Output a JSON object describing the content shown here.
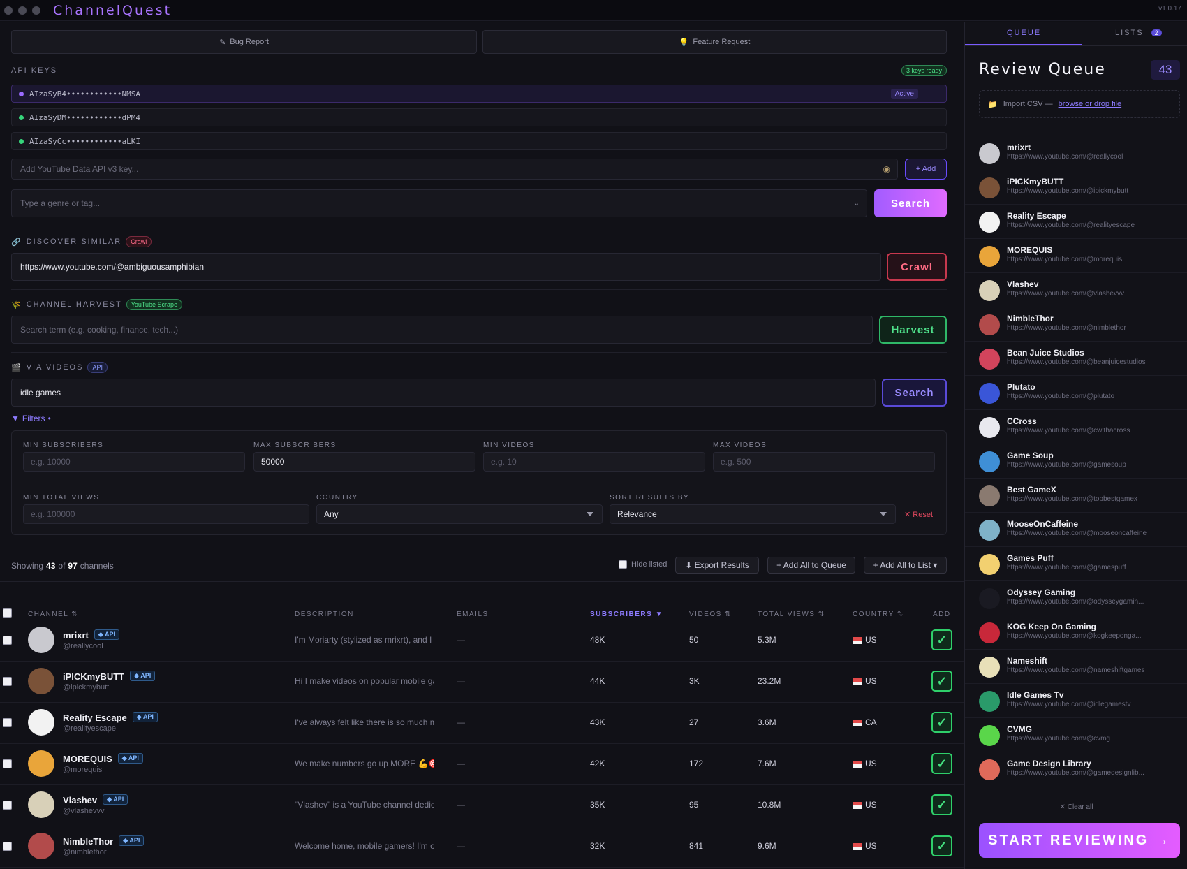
{
  "app": {
    "title": "ChannelQuest",
    "version": "v1.0.17"
  },
  "top_buttons": {
    "bug": "Bug Report",
    "feature": "Feature Request"
  },
  "api_keys": {
    "label": "API KEYS",
    "ready_badge": "3 keys ready",
    "keys": [
      {
        "value": "AIzaSyB4••••••••••••NMSA",
        "status": "Active"
      },
      {
        "value": "AIzaSyDM••••••••••••dPM4"
      },
      {
        "value": "AIzaSyCc••••••••••••aLKI"
      }
    ],
    "add_placeholder": "Add YouTube Data API v3 key...",
    "add_button": "+ Add"
  },
  "genre_search": {
    "placeholder": "Type a genre or tag...",
    "button": "Search"
  },
  "discover": {
    "label": "DISCOVER SIMILAR",
    "badge": "Crawl",
    "value": "https://www.youtube.com/@ambiguousamphibian",
    "button": "Crawl"
  },
  "harvest": {
    "label": "CHANNEL HARVEST",
    "badge": "YouTube Scrape",
    "placeholder": "Search term (e.g. cooking, finance, tech...)",
    "button": "Harvest"
  },
  "via_videos": {
    "label": "VIA VIDEOS",
    "badge": "API",
    "value": "idle games",
    "button": "Search"
  },
  "filters": {
    "toggle": "Filters",
    "min_subs": {
      "label": "MIN SUBSCRIBERS",
      "placeholder": "e.g. 10000"
    },
    "max_subs": {
      "label": "MAX SUBSCRIBERS",
      "value": "50000"
    },
    "min_videos": {
      "label": "MIN VIDEOS",
      "placeholder": "e.g. 10"
    },
    "max_videos": {
      "label": "MAX VIDEOS",
      "placeholder": "e.g. 500"
    },
    "min_views": {
      "label": "MIN TOTAL VIEWS",
      "placeholder": "e.g. 100000"
    },
    "country": {
      "label": "COUNTRY",
      "value": "Any"
    },
    "sort": {
      "label": "SORT RESULTS BY",
      "value": "Relevance"
    },
    "reset": "✕ Reset"
  },
  "results": {
    "showing_prefix": "Showing",
    "shown": "43",
    "of": "of",
    "total": "97",
    "suffix": "channels",
    "hide_listed": "Hide listed",
    "export": "⬇ Export Results",
    "add_all_queue": "+ Add All to Queue",
    "add_all_list": "+ Add All to List ▾"
  },
  "table": {
    "headers": {
      "channel": "CHANNEL ⇅",
      "description": "DESCRIPTION",
      "emails": "EMAILS",
      "subscribers": "SUBSCRIBERS ▼",
      "videos": "VIDEOS ⇅",
      "views": "TOTAL VIEWS ⇅",
      "country": "COUNTRY ⇅",
      "add": "ADD"
    },
    "api_tag": "◆ API",
    "rows": [
      {
        "name": "mrixrt",
        "handle": "@reallycool",
        "desc": "I'm Moriarty (stylized as mrixrt), and I make",
        "email": "—",
        "subs": "48K",
        "videos": "50",
        "views": "5.3M",
        "country": "US"
      },
      {
        "name": "iPICKmyBUTT",
        "handle": "@ipickmybutt",
        "desc": "Hi I make videos on popular mobile games",
        "email": "—",
        "subs": "44K",
        "videos": "3K",
        "views": "23.2M",
        "country": "US"
      },
      {
        "name": "Reality Escape",
        "handle": "@realityescape",
        "desc": "I've always felt like there is so much more",
        "email": "—",
        "subs": "43K",
        "videos": "27",
        "views": "3.6M",
        "country": "CA"
      },
      {
        "name": "MOREQUIS",
        "handle": "@morequis",
        "desc": "We make numbers go up MORE 💪🎯",
        "email": "—",
        "subs": "42K",
        "videos": "172",
        "views": "7.6M",
        "country": "US"
      },
      {
        "name": "Vlashev",
        "handle": "@vlashevvv",
        "desc": "\"Vlashev\" is a YouTube channel dedicated",
        "email": "—",
        "subs": "35K",
        "videos": "95",
        "views": "10.8M",
        "country": "US"
      },
      {
        "name": "NimbleThor",
        "handle": "@nimblethor",
        "desc": "Welcome home, mobile gamers! I'm o",
        "email": "—",
        "subs": "32K",
        "videos": "841",
        "views": "9.6M",
        "country": "US"
      },
      {
        "name": "Bean Juice Studios",
        "handle": "",
        "desc": "",
        "email": "",
        "subs": "",
        "videos": "",
        "views": "",
        "country": ""
      }
    ]
  },
  "sidebar": {
    "tabs": {
      "queue": "QUEUE",
      "lists": "LISTS",
      "lists_count": "2"
    },
    "title": "Review Queue",
    "count": "43",
    "import_text": "Import CSV —",
    "import_link": "browse or drop file",
    "queue": [
      {
        "name": "mrixrt",
        "url": "https://www.youtube.com/@reallycool",
        "color": "#c9c9cf"
      },
      {
        "name": "iPICKmyBUTT",
        "url": "https://www.youtube.com/@ipickmybutt",
        "color": "#7a5238"
      },
      {
        "name": "Reality Escape",
        "url": "https://www.youtube.com/@realityescape",
        "color": "#f2f2f2"
      },
      {
        "name": "MOREQUIS",
        "url": "https://www.youtube.com/@morequis",
        "color": "#e9a53a"
      },
      {
        "name": "Vlashev",
        "url": "https://www.youtube.com/@vlashevvv",
        "color": "#d8d0b8"
      },
      {
        "name": "NimbleThor",
        "url": "https://www.youtube.com/@nimblethor",
        "color": "#b24b4b"
      },
      {
        "name": "Bean Juice Studios",
        "url": "https://www.youtube.com/@beanjuicestudios",
        "color": "#d2445c"
      },
      {
        "name": "Plutato",
        "url": "https://www.youtube.com/@plutato",
        "color": "#3a56d8"
      },
      {
        "name": "CCross",
        "url": "https://www.youtube.com/@cwithacross",
        "color": "#e8e8ee"
      },
      {
        "name": "Game Soup",
        "url": "https://www.youtube.com/@gamesoup",
        "color": "#3f8fd6"
      },
      {
        "name": "Best GameX",
        "url": "https://www.youtube.com/@topbestgamex",
        "color": "#8a7a70"
      },
      {
        "name": "MooseOnCaffeine",
        "url": "https://www.youtube.com/@mooseoncaffeine",
        "color": "#7fb2c8"
      },
      {
        "name": "Games Puff",
        "url": "https://www.youtube.com/@gamespuff",
        "color": "#f2d070"
      },
      {
        "name": "Odyssey Gaming",
        "url": "https://www.youtube.com/@odysseygamin...",
        "color": "#1a1a22"
      },
      {
        "name": "KOG Keep On Gaming",
        "url": "https://www.youtube.com/@kogkeeponga...",
        "color": "#c8283a"
      },
      {
        "name": "Nameshift",
        "url": "https://www.youtube.com/@nameshiftgames",
        "color": "#e8e0b8"
      },
      {
        "name": "Idle Games Tv",
        "url": "https://www.youtube.com/@idlegamestv",
        "color": "#2a9a6a"
      },
      {
        "name": "CVMG",
        "url": "https://www.youtube.com/@cvmg",
        "color": "#5ad64a"
      },
      {
        "name": "Game Design Library",
        "url": "https://www.youtube.com/@gamedesignlib...",
        "color": "#e06a5a"
      }
    ],
    "clear_all": "✕ Clear all",
    "start_button": "START REVIEWING →"
  }
}
